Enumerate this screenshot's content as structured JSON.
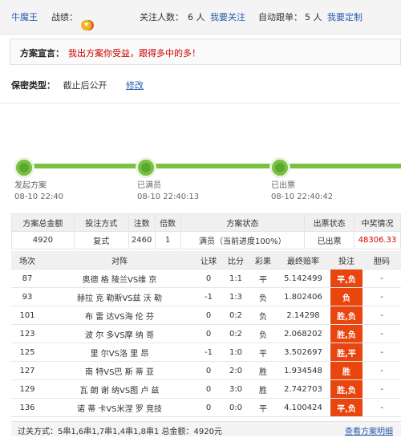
{
  "header": {
    "user": "牛魔王",
    "record_label": "战绩：",
    "followers_label": "关注人数：",
    "followers_count": "6 人",
    "follow_link": "我要关注",
    "auto_label": "自动跟单：",
    "auto_count": "5 人",
    "custom_link": "我要定制"
  },
  "declaration": {
    "label": "方案宣言：",
    "text": "我出方案你受益，跟得多中的多！"
  },
  "privacy": {
    "label": "保密类型：",
    "value": "截止后公开",
    "edit": "修改"
  },
  "progress": [
    {
      "label": "发起方案",
      "time": "08-10 22:40"
    },
    {
      "label": "已满员",
      "time": "08-10 22:40:13"
    },
    {
      "label": "已出票",
      "time": "08-10 22:40:42"
    }
  ],
  "summary": {
    "headers": [
      "方案总金额",
      "投注方式",
      "注数",
      "倍数",
      "方案状态",
      "出票状态",
      "中奖情况"
    ],
    "row": [
      "4920",
      "复式",
      "2460",
      "1",
      "满员（当前进度100%）",
      "已出票",
      "48306.33"
    ]
  },
  "matches": {
    "headers": [
      "场次",
      "对阵",
      "让球",
      "比分",
      "彩果",
      "最终赔率",
      "投注",
      "胆码"
    ],
    "rows": [
      [
        "87",
        "奥德 格 陵兰VS维 京",
        "0",
        "1:1",
        "平",
        "5.142499",
        "平,负",
        "-"
      ],
      [
        "93",
        "赫拉 克 勒斯VS兹 沃 勒",
        "-1",
        "1:3",
        "负",
        "1.802406",
        "负",
        "-"
      ],
      [
        "101",
        "布 雷 达VS海 伦 芬",
        "0",
        "0:2",
        "负",
        "2.14298",
        "胜,负",
        "-"
      ],
      [
        "123",
        "波 尔 多VS摩 纳 哥",
        "0",
        "0:2",
        "负",
        "2.068202",
        "胜,负",
        "-"
      ],
      [
        "125",
        "里 尔VS洛 里 昂",
        "-1",
        "1:0",
        "平",
        "3.502697",
        "胜,平",
        "-"
      ],
      [
        "127",
        "南 特VS巴 斯 蒂 亚",
        "0",
        "2:0",
        "胜",
        "1.934548",
        "胜",
        "-"
      ],
      [
        "129",
        "瓦 朗 谢 纳VS图 卢 兹",
        "0",
        "3:0",
        "胜",
        "2.742703",
        "胜,负",
        "-"
      ],
      [
        "136",
        "诺 蒂 卡VS米涅 罗 竞技",
        "0",
        "0:0",
        "平",
        "4.100424",
        "平,负",
        "-"
      ]
    ]
  },
  "footer": {
    "text": "过关方式：5串1,6串1,7串1,4串1,8串1 总金额：4920元",
    "link": "查看方案明细"
  },
  "colors": {
    "accent": "#e8450f",
    "progress": "#7ac143",
    "link": "#2a5db0"
  }
}
